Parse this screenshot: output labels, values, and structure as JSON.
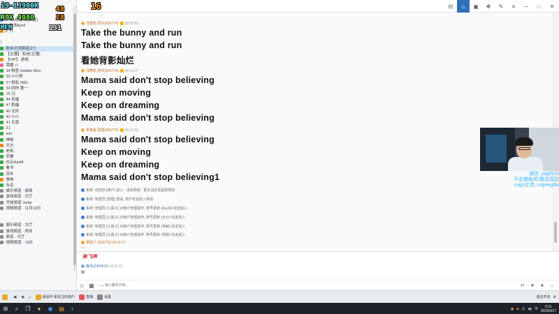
{
  "overlay": {
    "cpu_model": "i9-13900K",
    "gpu_model": "RTX 4080",
    "mem_label": "MEM",
    "cpu_temp": "48",
    "gpu_temp": "16",
    "cpu_usage": "28",
    "fps": "131"
  },
  "sidebar": {
    "rows": [
      {
        "text": "",
        "cls": "",
        "icon": ""
      },
      {
        "text": "",
        "cls": "",
        "icon": ""
      },
      {
        "text": "",
        "cls": "",
        "icon": ""
      },
      {
        "text": "1. 木v频道 (活跃度)",
        "cls": "",
        "icon": "blue"
      },
      {
        "text": "2. 在线Ayell",
        "cls": "",
        "icon": "blue"
      },
      {
        "text": "3. 分",
        "cls": "",
        "icon": "orange"
      },
      {
        "text": "",
        "cls": "",
        "icon": ""
      },
      {
        "text": "  1",
        "cls": "dim",
        "icon": ""
      },
      {
        "text": "  粉丝交流频道(27)",
        "cls": "sel",
        "icon": "green"
      },
      {
        "text": "   【主播】 私信(主播)",
        "cls": "",
        "icon": "green"
      },
      {
        "text": "   【VIP】 游戏",
        "cls": "",
        "icon": "orange"
      },
      {
        "text": "   荣耀 ☆",
        "cls": "",
        "icon": "pink"
      },
      {
        "text": "   34 鲸鱼 Golden Mon",
        "cls": "",
        "icon": "green"
      },
      {
        "text": "   33 小小熊",
        "cls": "",
        "icon": "green"
      },
      {
        "text": "   27 帆船 (NE)",
        "cls": "",
        "icon": "green"
      },
      {
        "text": "   33 同样 第一",
        "cls": "",
        "icon": "green"
      },
      {
        "text": "   15 沉",
        "cls": "",
        "icon": "green"
      },
      {
        "text": "   44 幸福",
        "cls": "",
        "icon": "green"
      },
      {
        "text": "   47 稻福",
        "cls": "",
        "icon": "green"
      },
      {
        "text": "   40 北风",
        "cls": "",
        "icon": "green"
      },
      {
        "text": "   42 小小",
        "cls": "",
        "icon": "green"
      },
      {
        "text": "   41 天南",
        "cls": "",
        "icon": "green"
      },
      {
        "text": "   21",
        "cls": "",
        "icon": "green"
      },
      {
        "text": "   wm",
        "cls": "",
        "icon": "green"
      },
      {
        "text": "   神秘",
        "cls": "",
        "icon": "green"
      },
      {
        "text": "   大分",
        "cls": "",
        "icon": "orange"
      },
      {
        "text": "   老街",
        "cls": "",
        "icon": "green"
      },
      {
        "text": "   安静",
        "cls": "",
        "icon": "green"
      },
      {
        "text": "   白云AyeM",
        "cls": "",
        "icon": "green"
      },
      {
        "text": "   看书",
        "cls": "",
        "icon": "green"
      },
      {
        "text": "   百年",
        "cls": "",
        "icon": "green"
      },
      {
        "text": "   食物",
        "cls": "",
        "icon": "orange"
      },
      {
        "text": "   永远",
        "cls": "",
        "icon": "green"
      },
      {
        "text": "  娱乐频道 · 游戏",
        "cls": "",
        "icon": "gray"
      },
      {
        "text": "  游戏频道 · 大厅",
        "cls": "",
        "icon": "gray"
      },
      {
        "text": "  开放频道 Jump",
        "cls": "",
        "icon": "gray"
      },
      {
        "text": "  视频频道 · 11月19日",
        "cls": "",
        "icon": "gray"
      },
      {
        "text": "",
        "cls": "",
        "icon": ""
      },
      {
        "text": "",
        "cls": "",
        "icon": ""
      },
      {
        "text": "  娱乐频道 · 大厅",
        "cls": "",
        "icon": "gray"
      },
      {
        "text": "  游戏频道 · 房间",
        "cls": "",
        "icon": "gray"
      },
      {
        "text": "  频道 · 大厅",
        "cls": "",
        "icon": "gray"
      },
      {
        "text": "  视频频道 · 19日",
        "cls": "",
        "icon": "gray"
      }
    ]
  },
  "chat": {
    "senders": [
      {
        "name": "洋葱机·烈炎(916770)",
        "time": "00:25:53"
      },
      {
        "name": "洋葱机·烈炎(916770)",
        "time": "00:11:07"
      },
      {
        "name": "零食屋·思思(916770)",
        "time": "00:13:56"
      }
    ],
    "lyrics": [
      "Take the bunny and run",
      "Take the bunny and run",
      "看她背影灿烂",
      "Mama said don't stop believing",
      "Keep on moving",
      "Keep on dreaming",
      "Mama said don't stop believing",
      "Mama said don't stop believing",
      "Keep on moving",
      "Keep on dreaming",
      "Mama said don't stop believing1"
    ],
    "system_lines": [
      "系统: 欢迎您 [用户] 进入 · 当前频道 · 更多消息请留意频道",
      "系统: 管理员 [管理] 邀请, 用户欢迎进入频道",
      "系统: 管理员 [小黑子] 对用户管理操作, 称号更新 (AyeM) 欢迎加入",
      "系统: 管理员 [小黑子] 对用户管理操作, 称号更新 (大分) 欢迎加入",
      "系统: 管理员 [小黑子] 对用户管理操作, 称号更新 (神秘) 欢迎加入",
      "系统: 管理员 [小黑子] 对用户管理操作, 称号更新 (老街) 欢迎加入"
    ],
    "notice": "赞助了 (916770) 00:11:17",
    "divider": "~~"
  },
  "composer": {
    "draft_text": "秋飞声",
    "reply_name": "晚风(2350911)",
    "reply_time": "00:11:07",
    "reply_text": "嗯",
    "placeholder": "输入聊天内容..."
  },
  "webcam": {
    "caption_1": "微信: pig8520",
    "caption_2": "不定期抽奖/赠送周边",
    "caption_3": "csgo交流: csgoegdw"
  },
  "taskbar": {
    "apps": [
      "通话中 新关注的用户",
      "直播",
      "设置"
    ],
    "clock_time": "0:11",
    "clock_date": "2023/4/17",
    "tray_label": "语言开关",
    "tray_label2": "中"
  },
  "colors": {
    "accent": "#2f6fb8",
    "lyric": "#111111"
  }
}
